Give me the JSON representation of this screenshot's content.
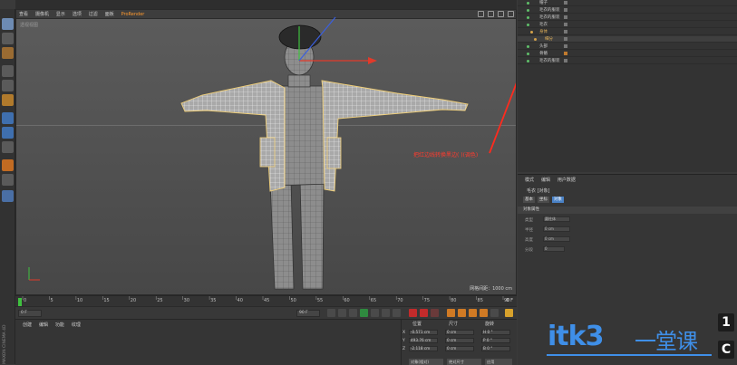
{
  "viewport": {
    "menu": [
      "查看",
      "摄像机",
      "显示",
      "选项",
      "过滤",
      "面板",
      "ProRender"
    ],
    "label": "透视视图",
    "grid_span": "网格间距：1000 cm",
    "annotation": "把红边线转换黑边(  )(调色)"
  },
  "object_manager": {
    "items": [
      {
        "name": "帽子",
        "color": "#5fbf6a"
      },
      {
        "name": "毛衣的服装",
        "color": "#5fbf6a"
      },
      {
        "name": "毛衣的服装",
        "color": "#5fbf6a"
      },
      {
        "name": "毛衣",
        "color": "#5fbf6a"
      },
      {
        "name": "身体",
        "color": "#d4a24a"
      },
      {
        "name": "细分",
        "color": "#d4a24a"
      },
      {
        "name": "头部",
        "color": "#5fbf6a"
      },
      {
        "name": "骨骼",
        "color": "#5fbf6a"
      },
      {
        "name": "毛衣的服装",
        "color": "#5fbf6a"
      }
    ]
  },
  "attribute_manager": {
    "menu": [
      "模式",
      "编辑",
      "用户数据"
    ],
    "object_label": "毛衣 [对象]",
    "tabs": [
      "基本",
      "坐标",
      "对象"
    ],
    "active_tab": "对象",
    "section": "对象属性",
    "rows": [
      {
        "label": "类型",
        "value": "圆柱体"
      },
      {
        "label": "半径",
        "value": "0 cm"
      },
      {
        "label": "高度",
        "value": "0 cm"
      },
      {
        "label": "分段",
        "value": "0"
      }
    ]
  },
  "timeline": {
    "ticks": [
      "0",
      "5",
      "10",
      "15",
      "20",
      "25",
      "30",
      "35",
      "40",
      "45",
      "50",
      "55",
      "60",
      "65",
      "70",
      "75",
      "80",
      "85",
      "90"
    ],
    "current_frame": "0 F"
  },
  "playback": {
    "start_field": "0 F",
    "end_field": "90 F"
  },
  "material": {
    "menu": [
      "创建",
      "编辑",
      "功能",
      "纹理"
    ]
  },
  "coordinates": {
    "headers": [
      "位置",
      "尺寸",
      "旋转"
    ],
    "rows": [
      {
        "axis": "X",
        "pos": "-0.571 cm",
        "size": "0 cm",
        "rot": "H 0 °"
      },
      {
        "axis": "Y",
        "pos": "493.76 cm",
        "size": "0 cm",
        "rot": "P 0 °"
      },
      {
        "axis": "Z",
        "pos": "-2.118 cm",
        "size": "0 cm",
        "rot": "B 0 °"
      }
    ],
    "mode_button": "对象(相对)",
    "size_button": "绝对尺寸",
    "apply_button": "应用"
  },
  "watermark": {
    "brand": "itk3",
    "cn": "一堂课",
    "tag1": "1",
    "tag2": "C"
  },
  "side_text": "MAXON CINEMA 4D"
}
